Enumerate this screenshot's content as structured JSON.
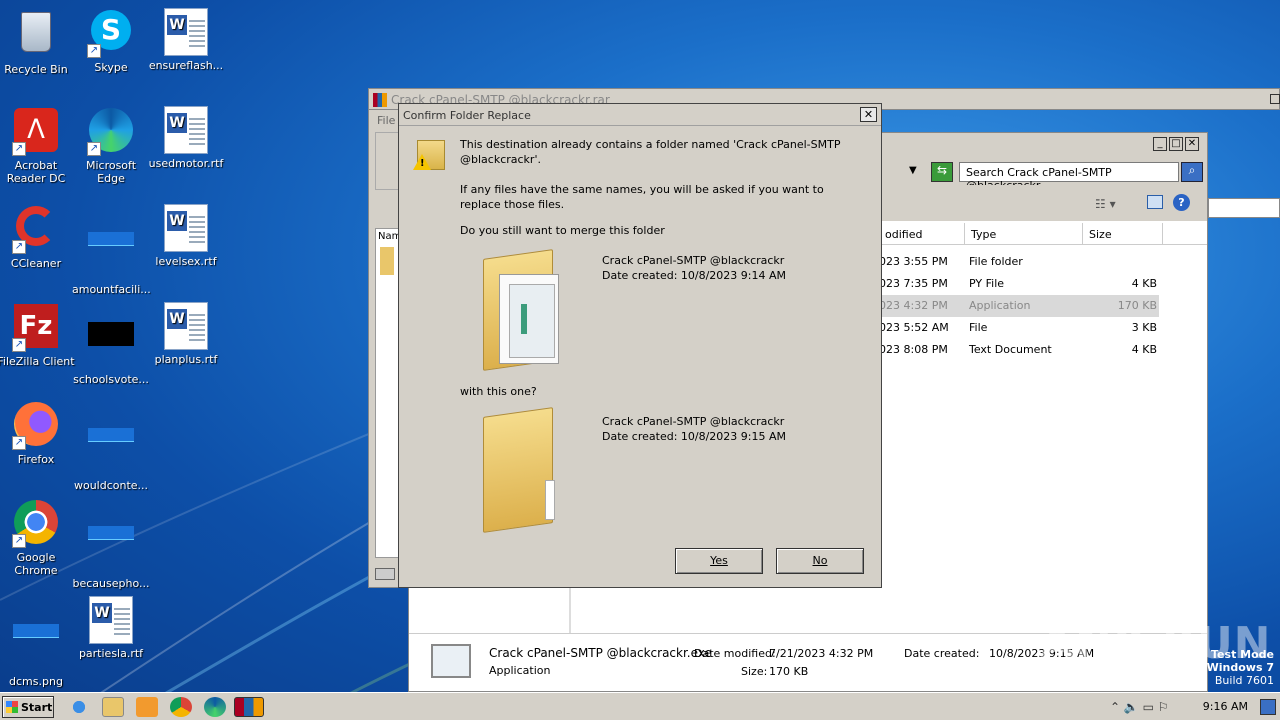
{
  "desktop": {
    "icons": [
      {
        "label": "Recycle Bin"
      },
      {
        "label": "Skype"
      },
      {
        "label": "ensureflash..."
      },
      {
        "label": "Acrobat Reader DC"
      },
      {
        "label": "Microsoft Edge"
      },
      {
        "label": "usedmotor.rtf"
      },
      {
        "label": "CCleaner"
      },
      {
        "label": "amountfacili..."
      },
      {
        "label": "levelsex.rtf"
      },
      {
        "label": "FileZilla Client"
      },
      {
        "label": "schoolsvote..."
      },
      {
        "label": "planplus.rtf"
      },
      {
        "label": "Firefox"
      },
      {
        "label": "wouldconte..."
      },
      {
        "label": "Google Chrome"
      },
      {
        "label": "becausepho..."
      },
      {
        "label": "dcms.png"
      },
      {
        "label": "partiesla.rtf"
      }
    ]
  },
  "winrar": {
    "title": "Crack cPanel-SMTP @blackcrackr.rar",
    "menu_file": "File",
    "col_name": "Nam"
  },
  "explorer": {
    "search_placeholder": "Search Crack cPanel-SMTP @blackcrackr",
    "columns": {
      "modified": "odified",
      "type": "Type",
      "size": "Size"
    },
    "rows": [
      {
        "date": "023 3:55 PM",
        "type": "File folder",
        "size": ""
      },
      {
        "date": "023 7:35 PM",
        "type": "PY File",
        "size": "4 KB"
      },
      {
        "date": "023 4:32 PM",
        "type": "Application",
        "size": "170 KB"
      },
      {
        "date": "023 5:52 AM",
        "type": "File",
        "size": "3 KB"
      },
      {
        "date": "023 8:08 PM",
        "type": "Text Document",
        "size": "4 KB"
      }
    ],
    "details": {
      "name": "Crack cPanel-SMTP @blackcrackr.exe",
      "kind": "Application",
      "modified_label": "Date modified:",
      "modified": "7/21/2023 4:32 PM",
      "size_label": "Size:",
      "size": "170 KB",
      "created_label": "Date created:",
      "created": "10/8/2023 9:15 AM"
    }
  },
  "dialog": {
    "title": "Confirm Folder Replace",
    "message1": "This destination already contains a folder named 'Crack cPanel-SMTP @blackcrackr'.",
    "message2": "If any files have the same names, you will be asked if you want to replace those files.",
    "question": "Do you still want to merge this folder",
    "folder1_name": "Crack cPanel-SMTP @blackcrackr",
    "folder1_date": "Date created: 10/8/2023 9:14 AM",
    "with_this": "with this one?",
    "folder2_name": "Crack cPanel-SMTP @blackcrackr",
    "folder2_date": "Date created: 10/8/2023 9:15 AM",
    "yes": "Yes",
    "no": "No",
    "close": "✕"
  },
  "taskbar": {
    "start": "Start",
    "clock": "9:16 AM"
  },
  "watermark": {
    "line1": "Test Mode",
    "line2": "Windows 7",
    "line3": "Build 7601",
    "brand": "ANY RUN"
  }
}
